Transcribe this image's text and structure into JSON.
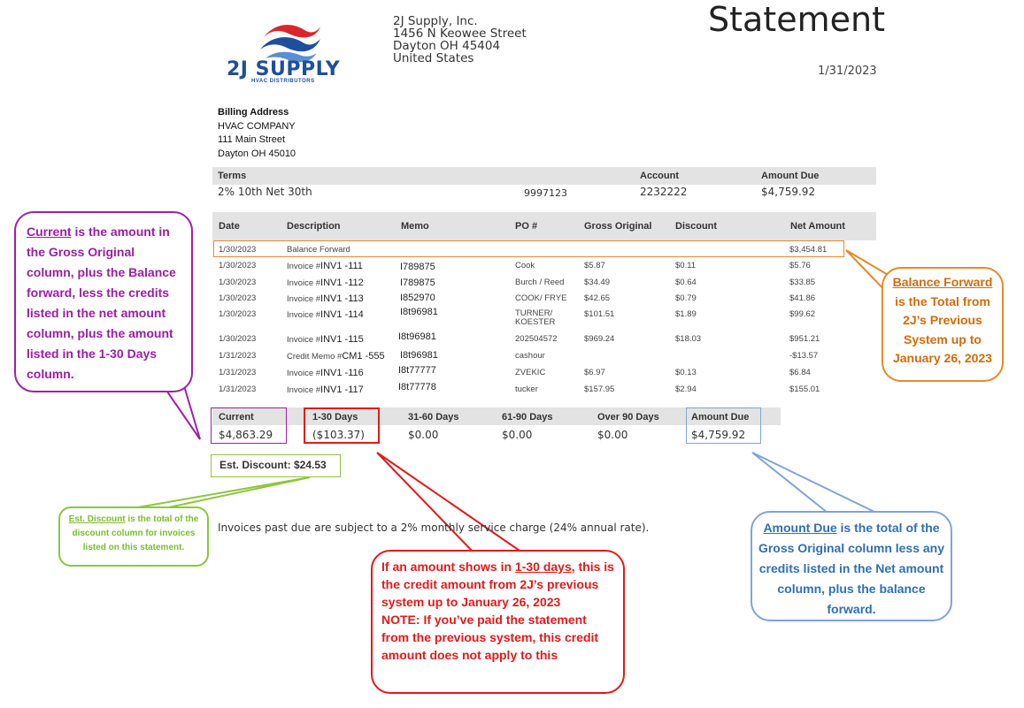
{
  "logo": {
    "name": "2J SUPPLY",
    "tagline": "HVAC DISTRIBUTORS"
  },
  "company": {
    "name": "2J Supply, Inc.",
    "street": "1456 N Keowee Street",
    "city": "Dayton OH 45404",
    "country": "United States"
  },
  "statement": {
    "title": "Statement",
    "date": "1/31/2023"
  },
  "billing": {
    "heading": "Billing Address",
    "name": "HVAC COMPANY",
    "street": "111 Main Street",
    "city": "Dayton OH 45010"
  },
  "terms": {
    "terms_label": "Terms",
    "terms_value": "2% 10th Net 30th",
    "extra_value": "9997123",
    "account_label": "Account",
    "account_value": "2232222",
    "amount_due_label": "Amount Due",
    "amount_due_value": "$4,759.92"
  },
  "lines": {
    "headers": [
      "Date",
      "Description",
      "Memo",
      "PO #",
      "Gross Original",
      "Discount",
      "Net Amount"
    ],
    "rows": [
      {
        "date": "1/30/2023",
        "desc": "Balance Forward",
        "inv": "",
        "memo": "",
        "po": "",
        "gross": "",
        "discount": "",
        "net": "$3,454.81"
      },
      {
        "date": "1/30/2023",
        "desc": "Invoice #",
        "inv": "INV1 -111",
        "memo": "I789875",
        "po": "Cook",
        "gross": "$5.87",
        "discount": "$0.11",
        "net": "$5.76"
      },
      {
        "date": "1/30/2023",
        "desc": "Invoice #",
        "inv": "INV1 -112",
        "memo": "I789875",
        "po": "Burch / Reed",
        "gross": "$34.49",
        "discount": "$0.64",
        "net": "$33.85"
      },
      {
        "date": "1/30/2023",
        "desc": "Invoice #",
        "inv": "INV1 -113",
        "memo": "I852970",
        "po": "COOK/ FRYE",
        "gross": "$42.65",
        "discount": "$0.79",
        "net": "$41.86"
      },
      {
        "date": "1/30/2023",
        "desc": "Invoice #",
        "inv": "INV1 -114",
        "memo": "I8t96981",
        "po": "TURNER/",
        "po2": "KOESTER",
        "gross": "$101.51",
        "discount": "$1.89",
        "net": "$99.62"
      },
      {
        "date": "1/30/2023",
        "desc": "Invoice #",
        "inv": "INV1 -115",
        "memo": "I8t96981",
        "po": "202504572",
        "gross": "$969.24",
        "discount": "$18.03",
        "net": "$951.21"
      },
      {
        "date": "1/31/2023",
        "desc": "Credit Memo #",
        "inv": "CM1 -555",
        "memo": "I8t96981",
        "po": "cashour",
        "gross": "",
        "discount": "",
        "net": "-$13.57"
      },
      {
        "date": "1/31/2023",
        "desc": "Invoice #",
        "inv": "INV1 -116",
        "memo": "I8t77777",
        "po": "ZVEKIC",
        "gross": "$6.97",
        "discount": "$0.13",
        "net": "$6.84"
      },
      {
        "date": "1/31/2023",
        "desc": "Invoice #",
        "inv": "INV1 -117",
        "memo": "I8t77778",
        "po": "tucker",
        "gross": "$157.95",
        "discount": "$2.94",
        "net": "$155.01"
      }
    ]
  },
  "aging": {
    "headers": [
      "Current",
      "1-30 Days",
      "31-60 Days",
      "61-90 Days",
      "Over 90 Days",
      "Amount Due"
    ],
    "values": [
      "$4,863.29",
      "($103.37)",
      "$0.00",
      "$0.00",
      "$0.00",
      "$4,759.92"
    ]
  },
  "est_discount": "Est. Discount: $24.53",
  "footer_note": "Invoices past due are subject to a 2% monthly service charge (24% annual rate).",
  "callouts": {
    "current": {
      "term": "Current",
      "text": " is the amount in the Gross Original column, plus the Balance forward, less the credits listed in the net amount column, plus the amount listed in the 1-30 Days column."
    },
    "balance_forward": {
      "term": "Balance Forward",
      "text": " is the Total from 2J’s Previous System up to January 26, 2023"
    },
    "est_discount": {
      "term": "Est. Discount",
      "text": " is the total of the discount column for invoices listed on this statement."
    },
    "one_thirty": {
      "pre": "If an amount shows in ",
      "term": "1-30 days",
      "text": ", this is the credit amount from 2J’s previous system up to January 26, 2023",
      "note": "NOTE: If you’ve paid the statement from the previous system, this credit amount does not apply to this"
    },
    "amount_due": {
      "term": "Amount Due",
      "text": " is the total of the Gross Original column less any credits listed in the Net amount column, plus the balance forward."
    }
  },
  "colors": {
    "purple": "#a020a8",
    "orange": "#e58a2c",
    "green": "#8dc63f",
    "red": "#e01b1b",
    "blue": "#7fa4d6",
    "logo_blue": "#1e4f9c",
    "logo_red": "#d9262b"
  }
}
